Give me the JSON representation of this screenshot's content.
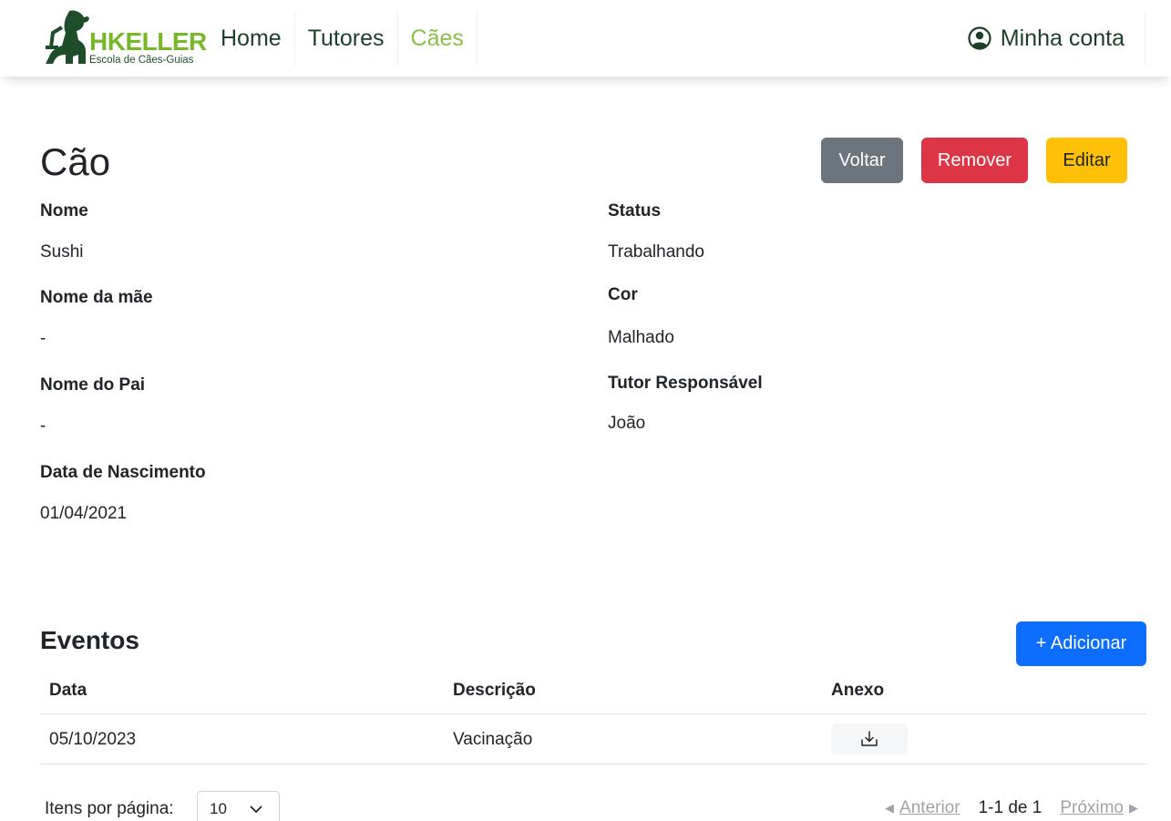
{
  "brand": {
    "name": "HKELLER",
    "subtitle": "Escola de Cães-Guias",
    "accent": "#76b82a",
    "dark": "#1d4d2b"
  },
  "nav": {
    "links": [
      {
        "label": "Home",
        "active": false
      },
      {
        "label": "Tutores",
        "active": false
      },
      {
        "label": "Cães",
        "active": true
      }
    ],
    "account": {
      "label": "Minha conta",
      "icon": "user-circle-icon"
    }
  },
  "page": {
    "title": "Cão",
    "buttons": {
      "back": "Voltar",
      "remove": "Remover",
      "edit": "Editar"
    }
  },
  "details": {
    "left": [
      {
        "label": "Nome",
        "value": "Sushi"
      },
      {
        "label": "Nome da mãe",
        "value": "-"
      },
      {
        "label": "Nome do Pai",
        "value": "-"
      },
      {
        "label": "Data de Nascimento",
        "value": "01/04/2021"
      }
    ],
    "right": [
      {
        "label": "Status",
        "value": "Trabalhando"
      },
      {
        "label": "Cor",
        "value": "Malhado"
      },
      {
        "label": "Tutor Responsável",
        "value": "João"
      }
    ]
  },
  "events": {
    "title": "Eventos",
    "add_label": "+ Adicionar",
    "columns": [
      "Data",
      "Descrição",
      "Anexo"
    ],
    "rows": [
      {
        "date": "05/10/2023",
        "description": "Vacinação",
        "attachment_icon": "download-icon"
      }
    ]
  },
  "pagination": {
    "per_page_label": "Itens por página:",
    "per_page_value": "10",
    "prev": "Anterior",
    "range": "1-1 de 1",
    "next": "Próximo"
  }
}
